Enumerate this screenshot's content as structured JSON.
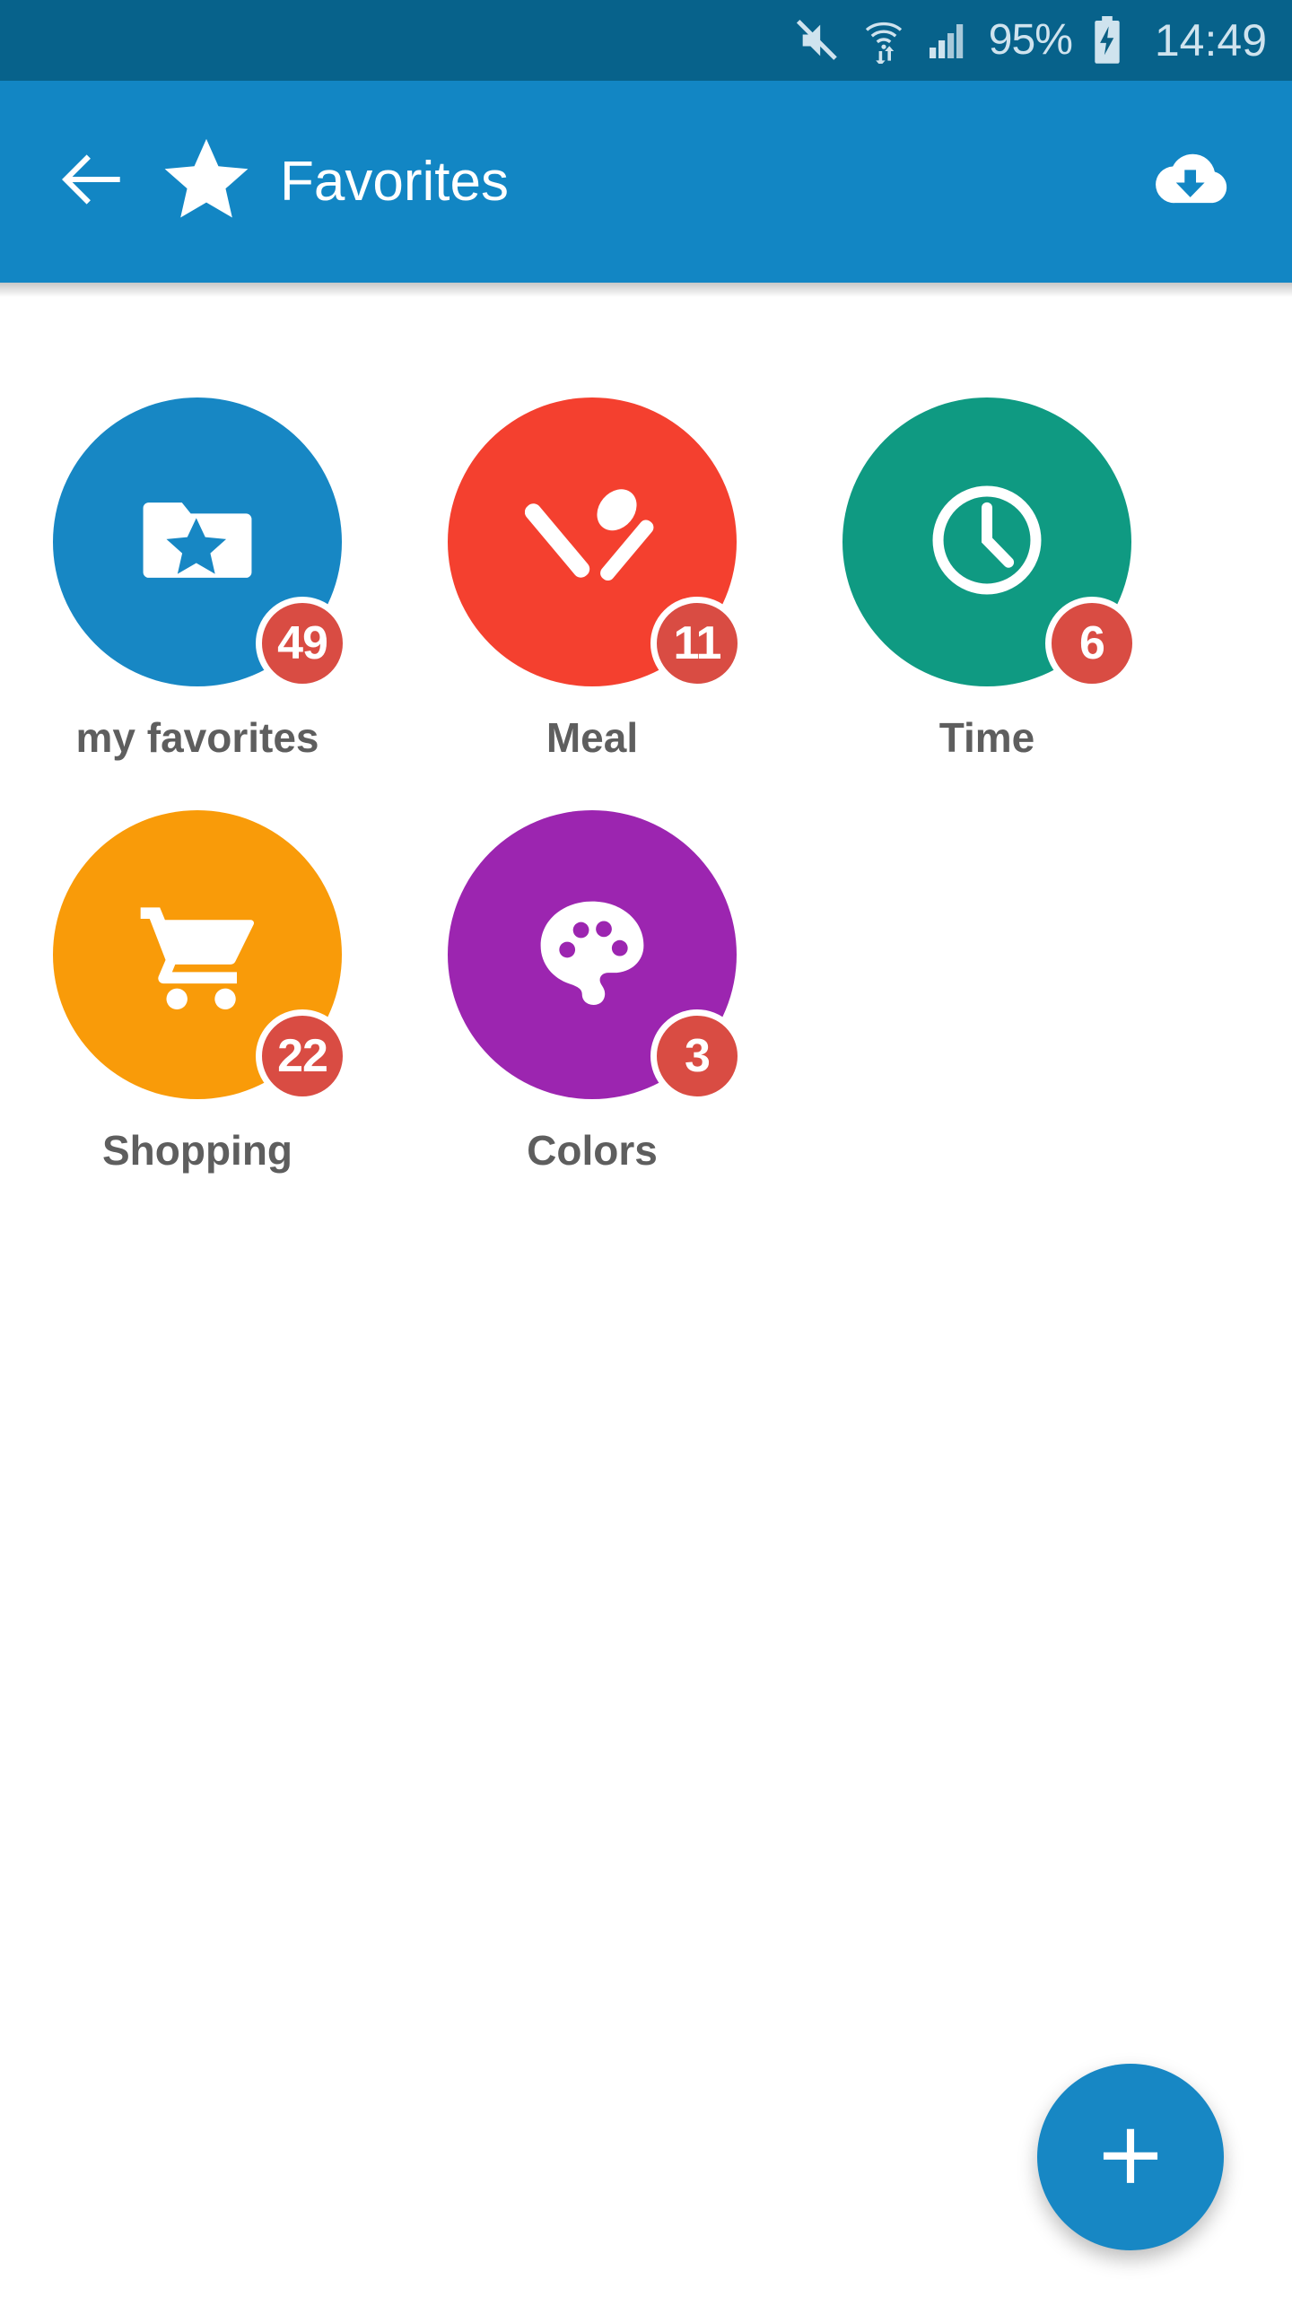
{
  "status_bar": {
    "background": "#07628b",
    "mute_icon": "volume-mute-icon",
    "wifi_icon": "wifi-transfer-icon",
    "signal_icon": "cellular-signal-icon",
    "battery_percent": "95%",
    "battery_icon": "battery-charging-icon",
    "clock": "14:49"
  },
  "app_bar": {
    "background": "#1286c4",
    "back_icon": "arrow-left-icon",
    "brand_icon": "star-icon",
    "title": "Favorites",
    "action_icon": "cloud-download-icon"
  },
  "grid": {
    "badge_color": "#d94c43",
    "items": [
      {
        "label": "my favorites",
        "count": "49",
        "color": "#1787c4",
        "icon": "folder-star-icon"
      },
      {
        "label": "Meal",
        "count": "11",
        "color": "#f4402f",
        "icon": "knife-spoon-icon"
      },
      {
        "label": "Time",
        "count": "6",
        "color": "#0f9a82",
        "icon": "clock-icon"
      },
      {
        "label": "Shopping",
        "count": "22",
        "color": "#f99b09",
        "icon": "shopping-cart-icon"
      },
      {
        "label": "Colors",
        "count": "3",
        "color": "#9c25b0",
        "icon": "palette-icon"
      }
    ]
  },
  "fab": {
    "icon": "plus-icon",
    "color": "#1787c4"
  }
}
